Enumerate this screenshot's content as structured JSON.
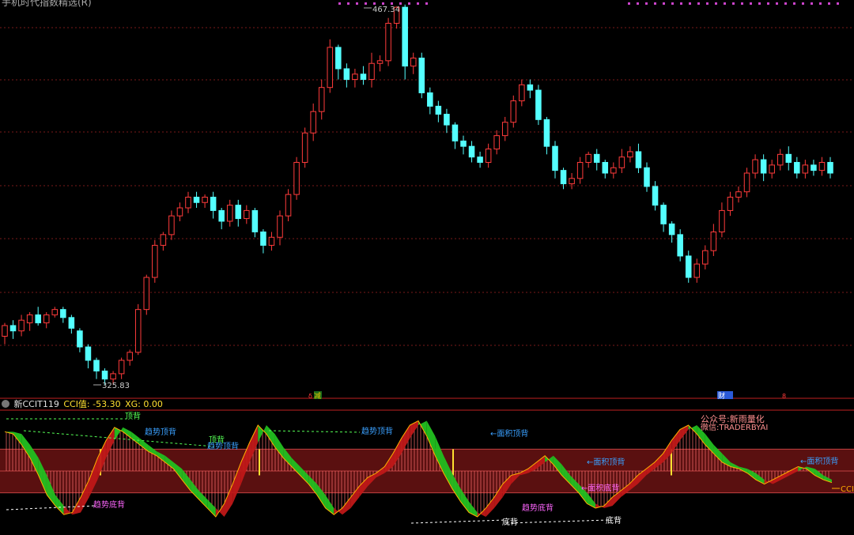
{
  "window": {
    "title": "手机时代指数精选(R)"
  },
  "colors": {
    "background": "#000000",
    "up_candle": "#ff3b3b",
    "down_candle": "#54ffff",
    "grid": "#7a1a1a",
    "separator": "#c02020",
    "band_fill": "#5a1010",
    "hist": "#ff7070",
    "green_area": "#22c020",
    "red_area": "#c01818",
    "label_blue": "#3aa0ff",
    "label_magenta": "#ff66ff",
    "label_green": "#55ff55",
    "label_white": "#ffffff",
    "marker_purple": "#cc44cc",
    "marker_yellow": "#ffe030",
    "header_yellow": "#ffe030"
  },
  "main_chart": {
    "high_label": "467.34",
    "low_label": "325.83"
  },
  "event_markers": [
    {
      "label": "减",
      "color": "#e8c100",
      "bg": "#1a6a1a"
    },
    {
      "label": "财",
      "color": "#ffffff",
      "bg": "#2a5ad8"
    },
    {
      "label": "8",
      "color": "#ff3b3b",
      "bg": ""
    }
  ],
  "indicator": {
    "name": "新CCIT119",
    "value_label": "CCI值: -53.30",
    "xg_label": "XG: 0.00",
    "line_label": "CCI"
  },
  "annotations": [
    {
      "text": "顶背",
      "color": "#55ff55"
    },
    {
      "text": "趋势顶背",
      "color": "#3aa0ff"
    },
    {
      "text": "顶背",
      "color": "#55ff55"
    },
    {
      "text": "趋势顶背",
      "color": "#3aa0ff"
    },
    {
      "text": "趋势底背",
      "color": "#ff66ff"
    },
    {
      "text": "趋势顶背",
      "color": "#3aa0ff"
    },
    {
      "text": "面积顶背",
      "color": "#3aa0ff"
    },
    {
      "text": "趋势底背",
      "color": "#ff66ff"
    },
    {
      "text": "底背",
      "color": "#ffffff"
    },
    {
      "text": "面积顶背",
      "color": "#3aa0ff"
    },
    {
      "text": "面积底背",
      "color": "#ff66ff"
    },
    {
      "text": "底背",
      "color": "#ffffff"
    },
    {
      "text": "面积顶背",
      "color": "#3aa0ff"
    }
  ],
  "watermark": {
    "line1": "公众号:新雨量化",
    "line2": "微信:TRADERBYAI"
  },
  "chart_data": {
    "type": "candlestick",
    "title": "",
    "high": 467.34,
    "low": 325.83,
    "candles": [
      [
        344,
        348,
        341,
        349
      ],
      [
        348,
        346,
        343,
        350
      ],
      [
        346,
        350,
        344,
        352
      ],
      [
        349,
        352,
        346,
        353
      ],
      [
        352,
        349,
        348,
        355
      ],
      [
        349,
        352,
        347,
        353
      ],
      [
        352,
        354,
        351,
        355
      ],
      [
        354,
        351,
        349,
        355
      ],
      [
        351,
        347,
        345,
        352
      ],
      [
        346,
        340,
        338,
        347
      ],
      [
        340,
        335,
        332,
        341
      ],
      [
        335,
        331,
        328,
        336
      ],
      [
        331,
        328,
        326,
        332
      ],
      [
        328,
        330,
        326,
        331
      ],
      [
        330,
        335,
        328,
        336
      ],
      [
        335,
        338,
        333,
        339
      ],
      [
        338,
        354,
        337,
        356
      ],
      [
        354,
        366,
        352,
        367
      ],
      [
        366,
        378,
        364,
        380
      ],
      [
        378,
        382,
        376,
        383
      ],
      [
        382,
        389,
        380,
        391
      ],
      [
        389,
        392,
        387,
        394
      ],
      [
        392,
        396,
        390,
        398
      ],
      [
        396,
        394,
        392,
        398
      ],
      [
        394,
        396,
        392,
        397
      ],
      [
        396,
        391,
        388,
        398
      ],
      [
        391,
        387,
        384,
        392
      ],
      [
        387,
        393,
        385,
        395
      ],
      [
        393,
        388,
        385,
        395
      ],
      [
        388,
        391,
        386,
        393
      ],
      [
        391,
        383,
        381,
        392
      ],
      [
        383,
        378,
        375,
        384
      ],
      [
        378,
        381,
        376,
        383
      ],
      [
        381,
        389,
        378,
        391
      ],
      [
        389,
        397,
        387,
        399
      ],
      [
        397,
        409,
        395,
        411
      ],
      [
        409,
        420,
        407,
        422
      ],
      [
        420,
        428,
        417,
        431
      ],
      [
        428,
        437,
        425,
        440
      ],
      [
        437,
        452,
        435,
        455
      ],
      [
        452,
        444,
        440,
        453
      ],
      [
        444,
        440,
        437,
        446
      ],
      [
        440,
        442,
        437,
        444
      ],
      [
        442,
        440,
        438,
        445
      ],
      [
        440,
        446,
        437,
        450
      ],
      [
        446,
        447,
        443,
        449
      ],
      [
        447,
        461,
        445,
        463
      ],
      [
        461,
        467,
        459,
        467.3
      ],
      [
        467,
        445,
        440,
        468
      ],
      [
        445,
        448,
        442,
        450
      ],
      [
        448,
        435,
        433,
        450
      ],
      [
        435,
        430,
        427,
        437
      ],
      [
        430,
        427,
        424,
        432
      ],
      [
        427,
        423,
        420,
        429
      ],
      [
        423,
        417,
        414,
        424
      ],
      [
        417,
        415,
        412,
        419
      ],
      [
        415,
        411,
        409,
        417
      ],
      [
        411,
        409,
        407,
        413
      ],
      [
        409,
        414,
        407,
        416
      ],
      [
        414,
        419,
        412,
        421
      ],
      [
        419,
        424,
        417,
        426
      ],
      [
        424,
        432,
        422,
        434
      ],
      [
        432,
        438,
        430,
        440
      ],
      [
        438,
        436,
        433,
        440
      ],
      [
        436,
        425,
        423,
        438
      ],
      [
        425,
        415,
        412,
        426
      ],
      [
        415,
        406,
        403,
        417
      ],
      [
        406,
        401,
        399,
        407
      ],
      [
        401,
        403,
        399,
        405
      ],
      [
        403,
        409,
        401,
        411
      ],
      [
        409,
        412,
        407,
        413
      ],
      [
        412,
        409,
        406,
        414
      ],
      [
        409,
        405,
        403,
        410
      ],
      [
        405,
        407,
        403,
        409
      ],
      [
        407,
        411,
        405,
        414
      ],
      [
        411,
        413,
        409,
        415
      ],
      [
        413,
        407,
        405,
        416
      ],
      [
        407,
        400,
        398,
        409
      ],
      [
        400,
        393,
        391,
        402
      ],
      [
        393,
        386,
        383,
        394
      ],
      [
        386,
        382,
        379,
        387
      ],
      [
        382,
        374,
        372,
        384
      ],
      [
        374,
        366,
        364,
        376
      ],
      [
        366,
        371,
        364,
        373
      ],
      [
        371,
        376,
        369,
        378
      ],
      [
        376,
        383,
        374,
        386
      ],
      [
        383,
        391,
        381,
        394
      ],
      [
        391,
        396,
        389,
        398
      ],
      [
        396,
        398,
        394,
        400
      ],
      [
        398,
        405,
        396,
        407
      ],
      [
        405,
        410,
        403,
        412
      ],
      [
        410,
        405,
        402,
        412
      ],
      [
        405,
        408,
        403,
        410
      ],
      [
        408,
        412,
        406,
        414
      ],
      [
        412,
        409,
        406,
        415
      ],
      [
        409,
        405,
        403,
        411
      ],
      [
        405,
        408,
        403,
        410
      ],
      [
        408,
        406,
        404,
        410
      ],
      [
        406,
        409,
        404,
        411
      ],
      [
        409,
        405,
        403,
        411
      ]
    ],
    "cci_series": {
      "name": "CCI",
      "last_value": -53.3,
      "values": [
        180,
        170,
        120,
        60,
        -20,
        -110,
        -160,
        -200,
        -190,
        -120,
        -40,
        60,
        140,
        200,
        180,
        150,
        120,
        90,
        70,
        40,
        10,
        -40,
        -90,
        -130,
        -170,
        -210,
        -150,
        -60,
        40,
        130,
        210,
        170,
        110,
        60,
        20,
        -20,
        -60,
        -110,
        -170,
        -200,
        -170,
        -120,
        -70,
        -30,
        -10,
        20,
        80,
        150,
        210,
        230,
        160,
        70,
        -10,
        -80,
        -140,
        -190,
        -210,
        -170,
        -120,
        -60,
        -20,
        -10,
        10,
        40,
        70,
        30,
        -20,
        -60,
        -100,
        -150,
        -170,
        -160,
        -120,
        -90,
        -60,
        -20,
        10,
        40,
        80,
        140,
        190,
        210,
        170,
        120,
        80,
        40,
        20,
        10,
        -10,
        -40,
        -60,
        -40,
        -20,
        0,
        20,
        10,
        -20,
        -40,
        -53.3
      ]
    },
    "cci_bands": [
      -100,
      0,
      100
    ]
  }
}
